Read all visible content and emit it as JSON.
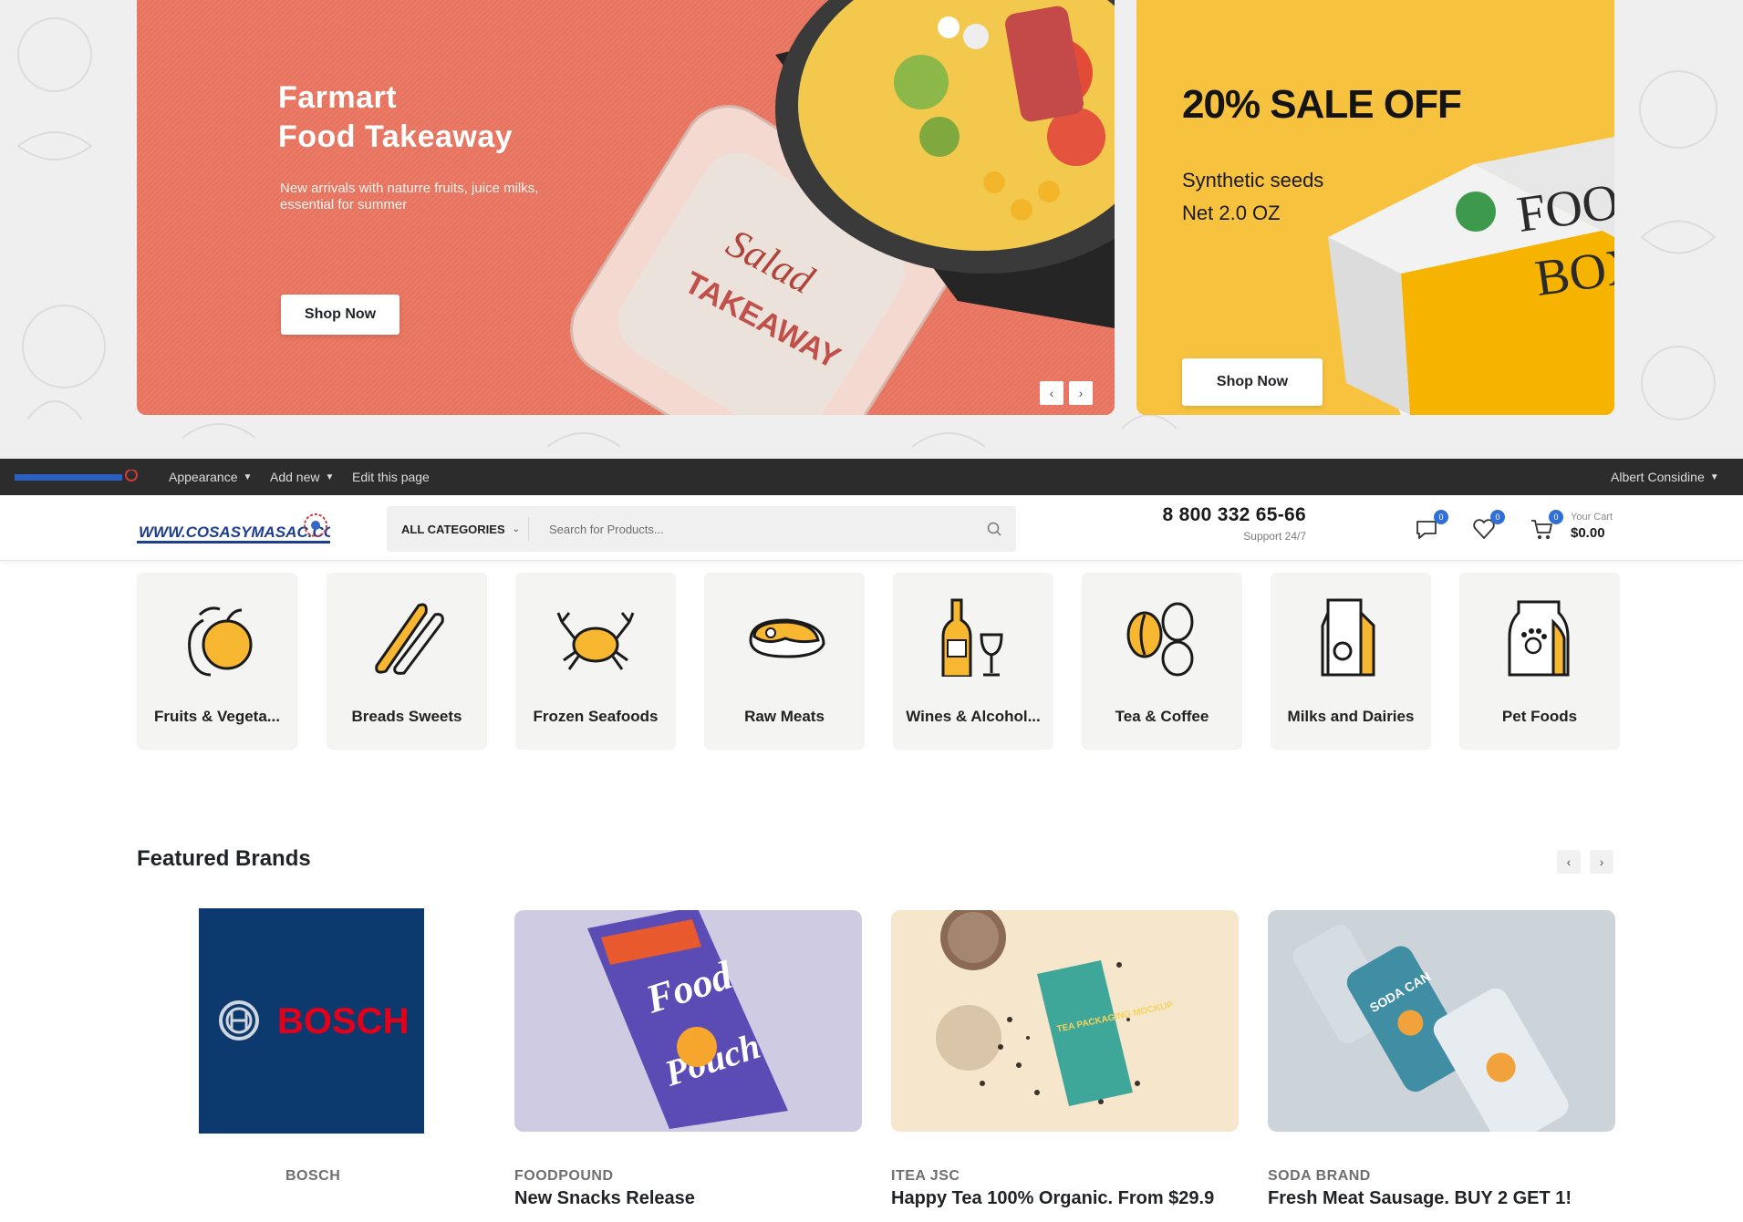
{
  "hero": {
    "main": {
      "title_line1": "Farmart",
      "title_line2": "Food Takeaway",
      "subtitle": "New arrivals with naturre fruits, juice milks, essential for summer",
      "button": "Shop Now",
      "prev": "‹",
      "next": "›"
    },
    "side": {
      "title": "20% SALE OFF",
      "subtitle_line1": "Synthetic seeds",
      "subtitle_line2": "Net 2.0 OZ",
      "button": "Shop Now"
    }
  },
  "admin_bar": {
    "logo_alt": "www.cosasymasac.com",
    "items": [
      {
        "label": "Appearance",
        "caret": "▼"
      },
      {
        "label": "Add new",
        "caret": "▼"
      },
      {
        "label": "Edit this page"
      }
    ],
    "user": "Albert Considine",
    "user_caret": "▼"
  },
  "header": {
    "logo_text": "WWW.COSASYMASAC.COM",
    "category_select": "ALL CATEGORIES",
    "search_placeholder": "Search for Products...",
    "phone": "8 800 332 65-66",
    "support": "Support 24/7",
    "compare_count": "0",
    "wishlist_count": "0",
    "cart_count": "0",
    "cart_label": "Your Cart",
    "cart_total": "$0.00"
  },
  "categories": [
    {
      "label": "Fruits & Vegeta...",
      "icon": "fruit-icon"
    },
    {
      "label": "Breads Sweets",
      "icon": "bread-icon"
    },
    {
      "label": "Frozen Seafoods",
      "icon": "crab-icon"
    },
    {
      "label": "Raw Meats",
      "icon": "steak-icon"
    },
    {
      "label": "Wines & Alcohol...",
      "icon": "wine-icon"
    },
    {
      "label": "Tea & Coffee",
      "icon": "coffee-beans-icon"
    },
    {
      "label": "Milks and Dairies",
      "icon": "milk-carton-icon"
    },
    {
      "label": "Pet Foods",
      "icon": "pet-food-bag-icon"
    }
  ],
  "featured": {
    "title": "Featured Brands",
    "prev": "‹",
    "next": "›",
    "brands": [
      {
        "name": "BOSCH",
        "logo_text": "BOSCH",
        "tagline": ""
      },
      {
        "name": "FOODPOUND",
        "tagline": "New Snacks Release",
        "pack_text1": "Food",
        "pack_text2": "Pouch"
      },
      {
        "name": "ITEA JSC",
        "tagline": "Happy Tea 100% Organic. From $29.9",
        "pack_text": "TEA PACKAGING MOCKUP"
      },
      {
        "name": "SODA BRAND",
        "tagline": "Fresh Meat Sausage. BUY 2 GET 1!",
        "pack_text": "SODA CAN"
      }
    ]
  },
  "colors": {
    "accent_yellow": "#f7b731",
    "banner_coral": "#ea7a66",
    "banner_yellow": "#f7c23e",
    "admin_bar": "#2c2c2c",
    "badge_blue": "#2f6fd6",
    "bosch_red": "#e2001a",
    "bosch_blue": "#0d3a6e"
  }
}
